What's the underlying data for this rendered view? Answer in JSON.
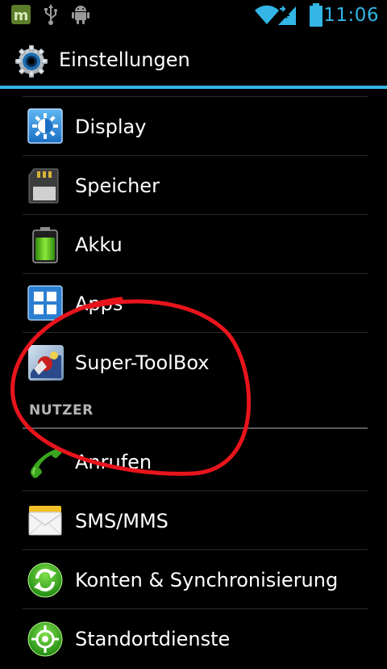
{
  "status_bar": {
    "time": "11:06",
    "icons": [
      "app-m-icon",
      "usb-icon",
      "android-debug-icon",
      "wifi-icon",
      "signal-icon",
      "battery-icon"
    ]
  },
  "action_bar": {
    "title": "Einstellungen",
    "icon": "settings-gear-icon",
    "accent_color": "#33b5e5"
  },
  "settings": {
    "items": [
      {
        "label": "Display",
        "icon": "display-brightness-icon"
      },
      {
        "label": "Speicher",
        "icon": "sd-card-icon"
      },
      {
        "label": "Akku",
        "icon": "battery-icon"
      },
      {
        "label": "Apps",
        "icon": "apps-grid-icon"
      },
      {
        "label": "Super-ToolBox",
        "icon": "super-toolbox-app-icon"
      }
    ],
    "section_user": "NUTZER",
    "user_items": [
      {
        "label": "Anrufen",
        "icon": "phone-icon"
      },
      {
        "label": "SMS/MMS",
        "icon": "envelope-icon"
      },
      {
        "label": "Konten & Synchronisierung",
        "icon": "sync-icon"
      },
      {
        "label": "Standortdienste",
        "icon": "location-icon"
      }
    ]
  },
  "annotation": {
    "color": "#e8141c"
  }
}
